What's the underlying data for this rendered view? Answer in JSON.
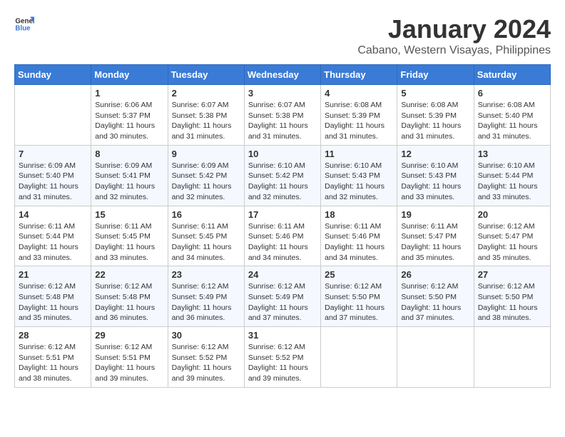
{
  "logo": {
    "text_general": "General",
    "text_blue": "Blue"
  },
  "title": "January 2024",
  "location": "Cabano, Western Visayas, Philippines",
  "days_of_week": [
    "Sunday",
    "Monday",
    "Tuesday",
    "Wednesday",
    "Thursday",
    "Friday",
    "Saturday"
  ],
  "weeks": [
    [
      {
        "day": "",
        "sunrise": "",
        "sunset": "",
        "daylight": ""
      },
      {
        "day": "1",
        "sunrise": "6:06 AM",
        "sunset": "5:37 PM",
        "daylight": "11 hours and 30 minutes."
      },
      {
        "day": "2",
        "sunrise": "6:07 AM",
        "sunset": "5:38 PM",
        "daylight": "11 hours and 31 minutes."
      },
      {
        "day": "3",
        "sunrise": "6:07 AM",
        "sunset": "5:38 PM",
        "daylight": "11 hours and 31 minutes."
      },
      {
        "day": "4",
        "sunrise": "6:08 AM",
        "sunset": "5:39 PM",
        "daylight": "11 hours and 31 minutes."
      },
      {
        "day": "5",
        "sunrise": "6:08 AM",
        "sunset": "5:39 PM",
        "daylight": "11 hours and 31 minutes."
      },
      {
        "day": "6",
        "sunrise": "6:08 AM",
        "sunset": "5:40 PM",
        "daylight": "11 hours and 31 minutes."
      }
    ],
    [
      {
        "day": "7",
        "sunrise": "6:09 AM",
        "sunset": "5:40 PM",
        "daylight": "11 hours and 31 minutes."
      },
      {
        "day": "8",
        "sunrise": "6:09 AM",
        "sunset": "5:41 PM",
        "daylight": "11 hours and 32 minutes."
      },
      {
        "day": "9",
        "sunrise": "6:09 AM",
        "sunset": "5:42 PM",
        "daylight": "11 hours and 32 minutes."
      },
      {
        "day": "10",
        "sunrise": "6:10 AM",
        "sunset": "5:42 PM",
        "daylight": "11 hours and 32 minutes."
      },
      {
        "day": "11",
        "sunrise": "6:10 AM",
        "sunset": "5:43 PM",
        "daylight": "11 hours and 32 minutes."
      },
      {
        "day": "12",
        "sunrise": "6:10 AM",
        "sunset": "5:43 PM",
        "daylight": "11 hours and 33 minutes."
      },
      {
        "day": "13",
        "sunrise": "6:10 AM",
        "sunset": "5:44 PM",
        "daylight": "11 hours and 33 minutes."
      }
    ],
    [
      {
        "day": "14",
        "sunrise": "6:11 AM",
        "sunset": "5:44 PM",
        "daylight": "11 hours and 33 minutes."
      },
      {
        "day": "15",
        "sunrise": "6:11 AM",
        "sunset": "5:45 PM",
        "daylight": "11 hours and 33 minutes."
      },
      {
        "day": "16",
        "sunrise": "6:11 AM",
        "sunset": "5:45 PM",
        "daylight": "11 hours and 34 minutes."
      },
      {
        "day": "17",
        "sunrise": "6:11 AM",
        "sunset": "5:46 PM",
        "daylight": "11 hours and 34 minutes."
      },
      {
        "day": "18",
        "sunrise": "6:11 AM",
        "sunset": "5:46 PM",
        "daylight": "11 hours and 34 minutes."
      },
      {
        "day": "19",
        "sunrise": "6:11 AM",
        "sunset": "5:47 PM",
        "daylight": "11 hours and 35 minutes."
      },
      {
        "day": "20",
        "sunrise": "6:12 AM",
        "sunset": "5:47 PM",
        "daylight": "11 hours and 35 minutes."
      }
    ],
    [
      {
        "day": "21",
        "sunrise": "6:12 AM",
        "sunset": "5:48 PM",
        "daylight": "11 hours and 35 minutes."
      },
      {
        "day": "22",
        "sunrise": "6:12 AM",
        "sunset": "5:48 PM",
        "daylight": "11 hours and 36 minutes."
      },
      {
        "day": "23",
        "sunrise": "6:12 AM",
        "sunset": "5:49 PM",
        "daylight": "11 hours and 36 minutes."
      },
      {
        "day": "24",
        "sunrise": "6:12 AM",
        "sunset": "5:49 PM",
        "daylight": "11 hours and 37 minutes."
      },
      {
        "day": "25",
        "sunrise": "6:12 AM",
        "sunset": "5:50 PM",
        "daylight": "11 hours and 37 minutes."
      },
      {
        "day": "26",
        "sunrise": "6:12 AM",
        "sunset": "5:50 PM",
        "daylight": "11 hours and 37 minutes."
      },
      {
        "day": "27",
        "sunrise": "6:12 AM",
        "sunset": "5:50 PM",
        "daylight": "11 hours and 38 minutes."
      }
    ],
    [
      {
        "day": "28",
        "sunrise": "6:12 AM",
        "sunset": "5:51 PM",
        "daylight": "11 hours and 38 minutes."
      },
      {
        "day": "29",
        "sunrise": "6:12 AM",
        "sunset": "5:51 PM",
        "daylight": "11 hours and 39 minutes."
      },
      {
        "day": "30",
        "sunrise": "6:12 AM",
        "sunset": "5:52 PM",
        "daylight": "11 hours and 39 minutes."
      },
      {
        "day": "31",
        "sunrise": "6:12 AM",
        "sunset": "5:52 PM",
        "daylight": "11 hours and 39 minutes."
      },
      {
        "day": "",
        "sunrise": "",
        "sunset": "",
        "daylight": ""
      },
      {
        "day": "",
        "sunrise": "",
        "sunset": "",
        "daylight": ""
      },
      {
        "day": "",
        "sunrise": "",
        "sunset": "",
        "daylight": ""
      }
    ]
  ]
}
